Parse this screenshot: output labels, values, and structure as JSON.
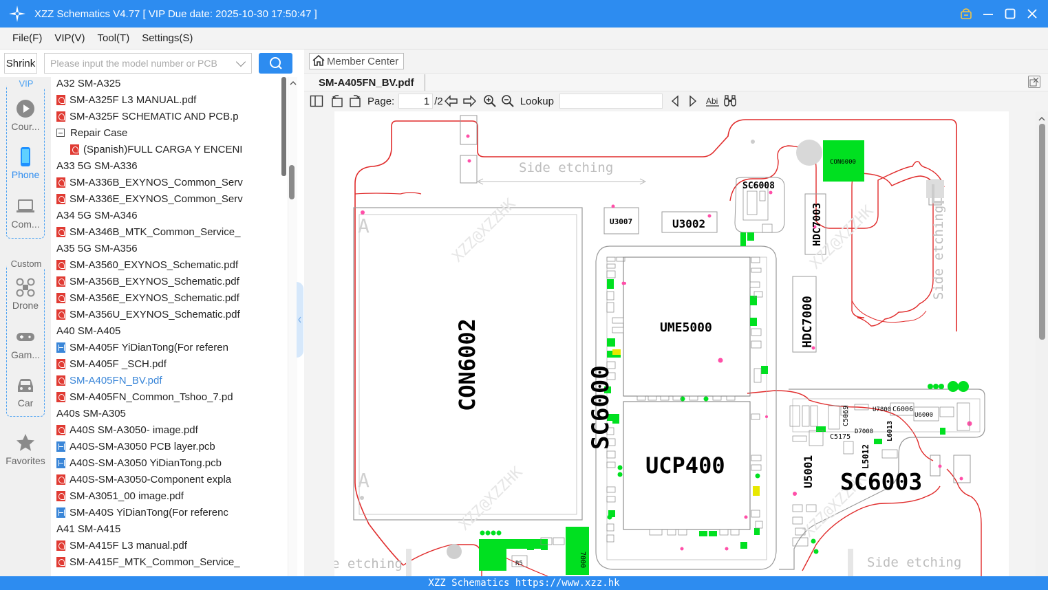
{
  "window": {
    "title": "XZZ Schematics V4.77 [ VIP Due date: 2025-10-30 17:50:47 ]"
  },
  "menu": [
    "File(F)",
    "VIP(V)",
    "Tool(T)",
    "Settings(S)"
  ],
  "sidebar": {
    "shrink_label": "Shrink",
    "search_placeholder": "Please input the model number or PCB",
    "vip_label": "VIP",
    "custom_label": "Custom",
    "favorites_label": "Favorites",
    "categories": [
      {
        "label": "Cour...",
        "icon": "play-icon"
      },
      {
        "label": "Phone",
        "icon": "phone-icon"
      },
      {
        "label": "Com...",
        "icon": "laptop-icon"
      },
      {
        "label": "Drone",
        "icon": "drone-icon"
      },
      {
        "label": "Gam...",
        "icon": "gamepad-icon"
      },
      {
        "label": "Car",
        "icon": "car-icon"
      }
    ]
  },
  "tree": [
    {
      "type": "folder",
      "label": "A32 SM-A325",
      "level": 0
    },
    {
      "type": "pdf",
      "label": "SM-A325F L3 MANUAL.pdf",
      "level": 1
    },
    {
      "type": "pdf",
      "label": "SM-A325F SCHEMATIC AND PCB.p",
      "level": 1
    },
    {
      "type": "folder",
      "label": "Repair Case",
      "level": 1
    },
    {
      "type": "pdf",
      "label": "(Spanish)FULL CARGA Y ENCENI",
      "level": 2
    },
    {
      "type": "folder",
      "label": "A33 5G SM-A336",
      "level": 0
    },
    {
      "type": "pdf",
      "label": "SM-A336B_EXYNOS_Common_Serv",
      "level": 1
    },
    {
      "type": "pdf",
      "label": "SM-A336E_EXYNOS_Common_Serv",
      "level": 1
    },
    {
      "type": "folder",
      "label": "A34 5G SM-A346",
      "level": 0
    },
    {
      "type": "pdf",
      "label": "SM-A346B_MTK_Common_Service_",
      "level": 1
    },
    {
      "type": "folder",
      "label": "A35 5G SM-A356",
      "level": 0
    },
    {
      "type": "pdf",
      "label": "SM-A3560_EXYNOS_Schematic.pdf",
      "level": 1
    },
    {
      "type": "pdf",
      "label": "SM-A356B_EXYNOS_Schematic.pdf",
      "level": 1
    },
    {
      "type": "pdf",
      "label": "SM-A356E_EXYNOS_Schematic.pdf",
      "level": 1
    },
    {
      "type": "pdf",
      "label": "SM-A356U_EXYNOS_Schematic.pdf",
      "level": 1
    },
    {
      "type": "folder",
      "label": "A40 SM-A405",
      "level": 0
    },
    {
      "type": "pcb",
      "label": "SM-A405F YiDianTong(For referen",
      "level": 1
    },
    {
      "type": "pdf",
      "label": "SM-A405F _SCH.pdf",
      "level": 1
    },
    {
      "type": "pdf",
      "label": "SM-A405FN_BV.pdf",
      "level": 1,
      "selected": true
    },
    {
      "type": "pdf",
      "label": "SM-A405FN_Common_Tshoo_7.pd",
      "level": 1
    },
    {
      "type": "folder",
      "label": "A40s SM-A305",
      "level": 0
    },
    {
      "type": "pdf",
      "label": "A40S SM-A3050- image.pdf",
      "level": 1
    },
    {
      "type": "pcb",
      "label": "A40S-SM-A3050 PCB layer.pcb",
      "level": 1
    },
    {
      "type": "pcb",
      "label": "A40S-SM-A3050 YiDianTong.pcb",
      "level": 1
    },
    {
      "type": "pdf",
      "label": "A40S-SM-A3050-Component expla",
      "level": 1
    },
    {
      "type": "pdf",
      "label": "SM-A3051_00 image.pdf",
      "level": 1
    },
    {
      "type": "pcb",
      "label": "SM-A40S YiDianTong(For referenc",
      "level": 1
    },
    {
      "type": "folder",
      "label": "A41 SM-A415",
      "level": 0
    },
    {
      "type": "pdf",
      "label": "SM-A415F L3 manual.pdf",
      "level": 1
    },
    {
      "type": "pdf",
      "label": "SM-A415F_MTK_Common_Service_",
      "level": 1
    }
  ],
  "viewer": {
    "member_center": "Member Center",
    "tab_label": "SM-A405FN_BV.pdf",
    "page_label": "Page:",
    "page_current": "1",
    "page_total": "/2",
    "lookup_label": "Lookup",
    "lookup_value": "",
    "board": {
      "etching_top": "Side etching",
      "etching_right": "Side etching",
      "etching_bottom_left": "e etching",
      "etching_bottom_right": "Side etching",
      "watermark": "XZZ@XZZHK",
      "letter_a": "A",
      "components_large": [
        "CON6002",
        "SC6000",
        "UME5000",
        "UCP400",
        "SC6003",
        "HDC7000",
        "HDC7003",
        "U3002",
        "U3007",
        "SC6008",
        "CON6000",
        "U5001",
        "L5012",
        "L6013",
        "C5175",
        "C5069",
        "C6006",
        "U6000",
        "U7800",
        "D7000"
      ]
    }
  },
  "status": {
    "text": "XZZ Schematics https://www.xzz.hk"
  },
  "colors": {
    "accent": "#2d8cf0",
    "pcb_outline": "#e02b2b",
    "pad_green": "#00e020",
    "pad_yellow": "#e8e800",
    "marker_pink": "#ff4fa8"
  }
}
